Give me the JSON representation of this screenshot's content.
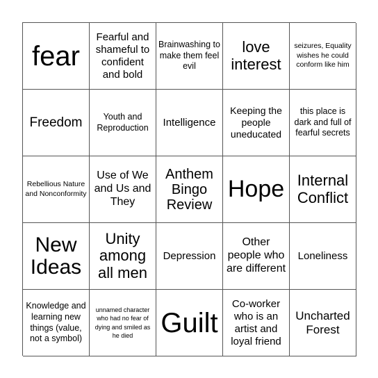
{
  "board": {
    "title": "Anthem Bingo Review",
    "cells": [
      {
        "text": "fear"
      },
      {
        "text": "Fearful and shameful to confident and bold"
      },
      {
        "text": "Brainwashing to make them feel evil"
      },
      {
        "text": "love interest"
      },
      {
        "text": "seizures, Equality wishes he could conform like him"
      },
      {
        "text": "Freedom"
      },
      {
        "text": "Youth and Reproduction"
      },
      {
        "text": "Intelligence"
      },
      {
        "text": "Keeping the people uneducated"
      },
      {
        "text": "this place is dark and full of fearful secrets"
      },
      {
        "text": "Rebellious Nature and Nonconformity"
      },
      {
        "text": "Use of We and Us and They"
      },
      {
        "text": "Anthem Bingo Review"
      },
      {
        "text": "Hope"
      },
      {
        "text": "Internal Conflict"
      },
      {
        "text": "New Ideas"
      },
      {
        "text": "Unity among all men"
      },
      {
        "text": "Depression"
      },
      {
        "text": "Other people who are different"
      },
      {
        "text": "Loneliness"
      },
      {
        "text": "Knowledge and learning new things (value, not a symbol)"
      },
      {
        "text": "unnamed character who had no fear of dying and smiled as he died"
      },
      {
        "text": "Guilt"
      },
      {
        "text": "Co-worker who is an artist and loyal friend"
      },
      {
        "text": "Uncharted Forest"
      }
    ]
  }
}
